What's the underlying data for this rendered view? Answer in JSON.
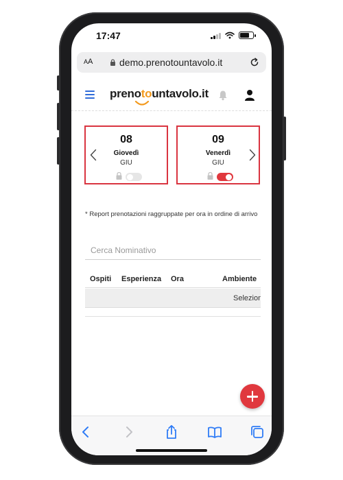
{
  "status_bar": {
    "time": "17:47"
  },
  "browser": {
    "text_size_label_small": "A",
    "text_size_label_large": "A",
    "url": "demo.prenotountavolo.it"
  },
  "app": {
    "logo_part1": "preno",
    "logo_part2": "to",
    "logo_part3": "untavolo.it"
  },
  "days": [
    {
      "number": "08",
      "name": "Giovedì",
      "meal": "GIU",
      "toggle_on": false
    },
    {
      "number": "09",
      "name": "Venerdì",
      "meal": "GIU",
      "toggle_on": true
    }
  ],
  "report_note": "* Report prenotazioni raggruppate per ora in ordine di arrivo",
  "search": {
    "placeholder": "Cerca Nominativo"
  },
  "table": {
    "headers": [
      "Ospiti",
      "Esperienza",
      "Ora",
      "Ambiente"
    ],
    "row_text": "Seleziona"
  },
  "colors": {
    "accent_blue": "#2f6bd9",
    "logo_orange": "#f39a1e",
    "card_red": "#d9333f",
    "fab_red": "#e0383e",
    "toggle_on": "#e0383e",
    "toggle_off": "#e6e6e6"
  }
}
